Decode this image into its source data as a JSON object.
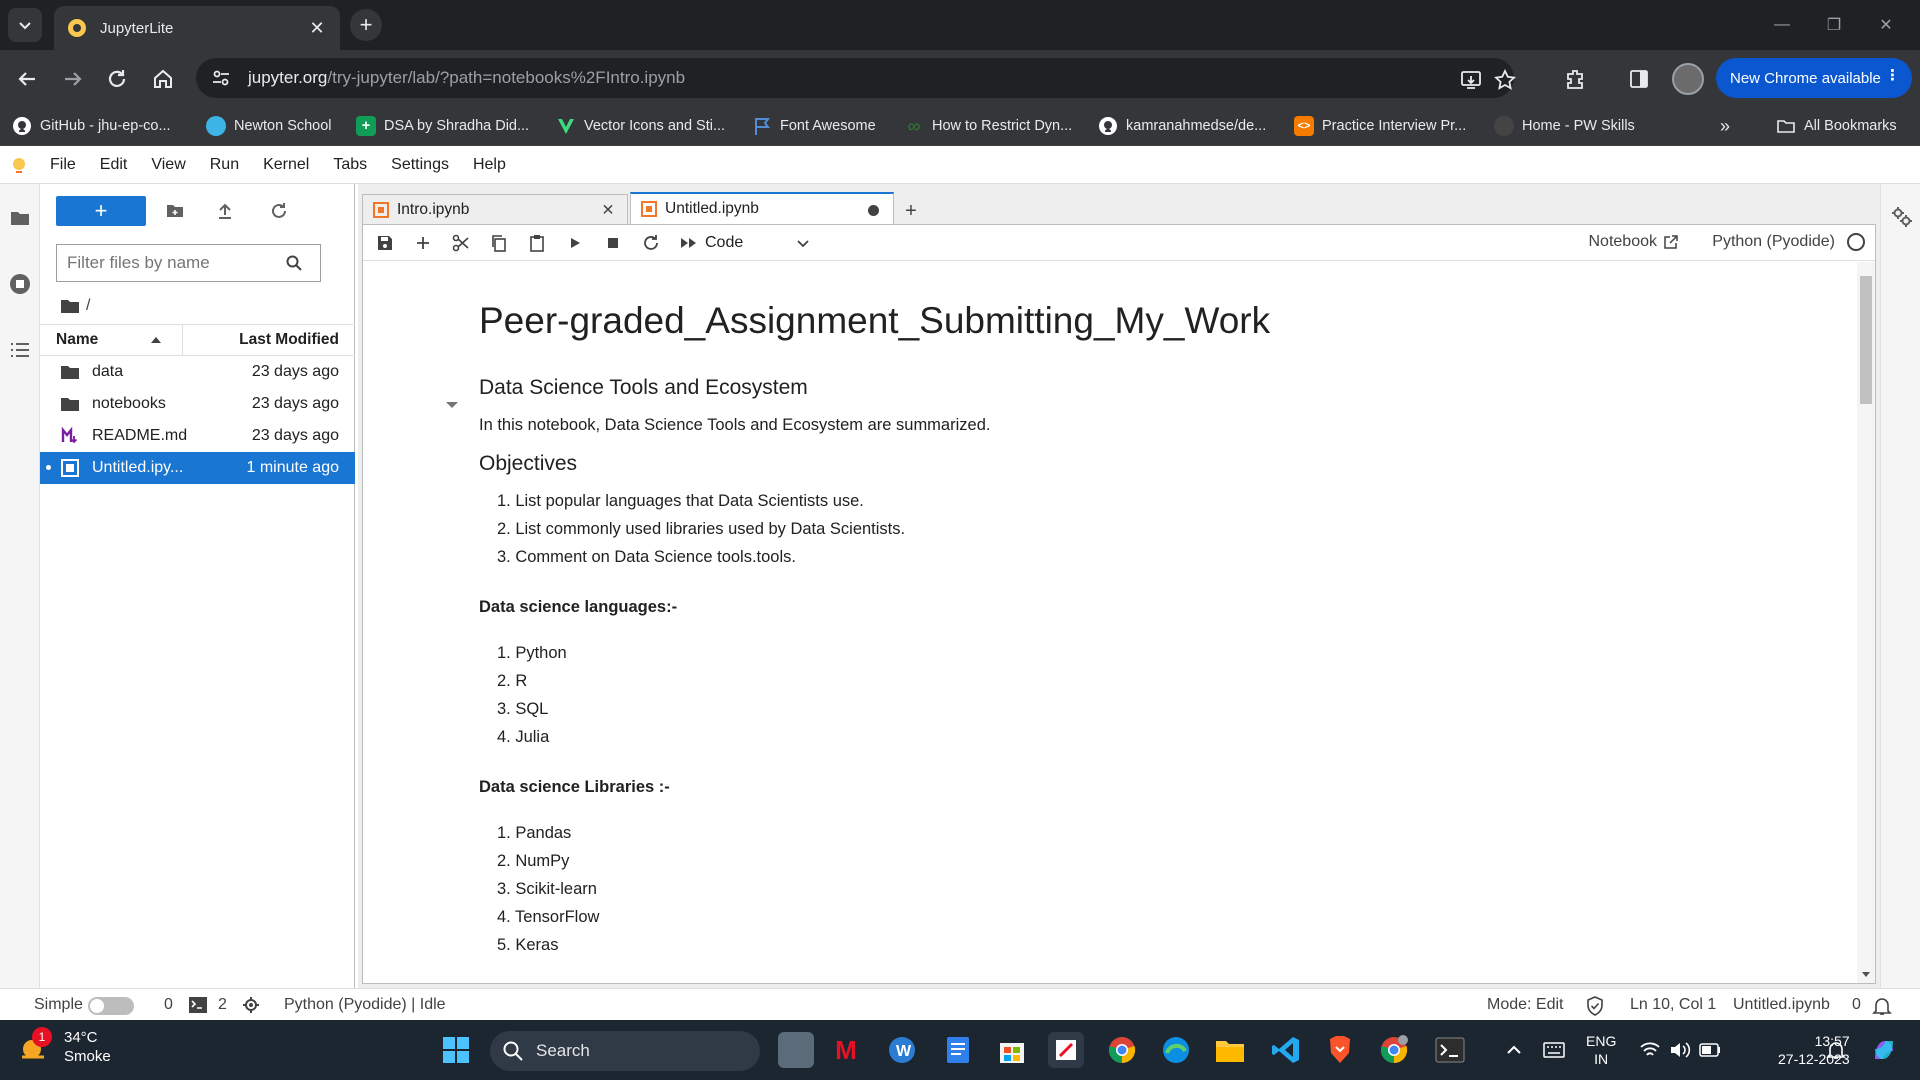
{
  "browser": {
    "tab_title": "JupyterLite",
    "url_host": "jupyter.org",
    "url_path": "/try-jupyter/lab/?path=notebooks%2FIntro.ipynb",
    "new_chrome_label": "New Chrome available",
    "bookmarks": [
      {
        "label": "GitHub - jhu-ep-co...",
        "icon": "github-icon",
        "color": "#ffffff"
      },
      {
        "label": "Newton School",
        "icon": "newton-school-icon",
        "color": "#3cb4e6"
      },
      {
        "label": "DSA by Shradha Did...",
        "icon": "sheets-icon",
        "color": "#0f9d58"
      },
      {
        "label": "Vector Icons and Sti...",
        "icon": "vector-icon",
        "color": "#3ddc84"
      },
      {
        "label": "Font Awesome",
        "icon": "flag-icon",
        "color": "#538dd7"
      },
      {
        "label": "How to Restrict Dyn...",
        "icon": "infinity-icon",
        "color": "#2e7d32"
      },
      {
        "label": "kamranahmedse/de...",
        "icon": "github-icon",
        "color": "#ffffff"
      },
      {
        "label": "Practice Interview Pr...",
        "icon": "code-icon",
        "color": "#f57c00"
      },
      {
        "label": "Home - PW Skills",
        "icon": "pw-skills-icon",
        "color": "#444444"
      }
    ],
    "all_bookmarks_label": "All Bookmarks"
  },
  "menubar": {
    "items": [
      "File",
      "Edit",
      "View",
      "Run",
      "Kernel",
      "Tabs",
      "Settings",
      "Help"
    ]
  },
  "filebrowser": {
    "new_label": "+",
    "filter_placeholder": "Filter files by name",
    "breadcrumb": "/",
    "col_name": "Name",
    "col_modified": "Last Modified",
    "files": [
      {
        "name": "data",
        "modified": "23 days ago",
        "icon": "folder-icon",
        "selected": false
      },
      {
        "name": "notebooks",
        "modified": "23 days ago",
        "icon": "folder-icon",
        "selected": false
      },
      {
        "name": "README.md",
        "modified": "23 days ago",
        "icon": "markdown-icon",
        "selected": false
      },
      {
        "name": "Untitled.ipy...",
        "modified": "1 minute ago",
        "icon": "notebook-icon",
        "selected": true
      }
    ]
  },
  "tabs": [
    {
      "label": "Intro.ipynb",
      "active": false
    },
    {
      "label": "Untitled.ipynb",
      "active": true
    }
  ],
  "toolbar": {
    "cell_type": "Code",
    "notebook_label": "Notebook",
    "kernel_label": "Python (Pyodide)"
  },
  "notebook": {
    "title": "Peer-graded_Assignment_Submitting_My_Work",
    "section_heading": "Data Science Tools and Ecosystem",
    "intro": "In this notebook, Data Science Tools and Ecosystem are summarized.",
    "objectives_heading": "Objectives",
    "objectives": [
      "1. List popular languages that Data Scientists use.",
      "2. List commonly used libraries used by Data Scientists.",
      "3. Comment on Data Science tools.tools."
    ],
    "languages_heading": "Data science languages:-",
    "languages": [
      "1. Python",
      "2. R",
      "3. SQL",
      "4. Julia"
    ],
    "libraries_heading": "Data science Libraries :-",
    "libraries": [
      "1. Pandas",
      "2. NumPy",
      "3. Scikit-learn",
      "4. TensorFlow",
      "5. Keras"
    ]
  },
  "statusbar": {
    "mode_label": "Simple",
    "terminals_count": "0",
    "kernels_count": "2",
    "kernel_status": "Python (Pyodide) | Idle",
    "edit_mode": "Mode: Edit",
    "cursor": "Ln 10, Col 1",
    "filename": "Untitled.ipynb",
    "notifications": "0"
  },
  "taskbar": {
    "temperature": "34°C",
    "weather": "Smoke",
    "weather_badge": "1",
    "search_label": "Search",
    "lang_line1": "ENG",
    "lang_line2": "IN",
    "time": "13:57",
    "date": "27-12-2023"
  },
  "colors": {
    "accent": "#1976d2",
    "chrome_dark": "#202124",
    "chrome_bar": "#35363a",
    "new_chrome": "#0b57d0",
    "taskbar": "#1c2631"
  }
}
